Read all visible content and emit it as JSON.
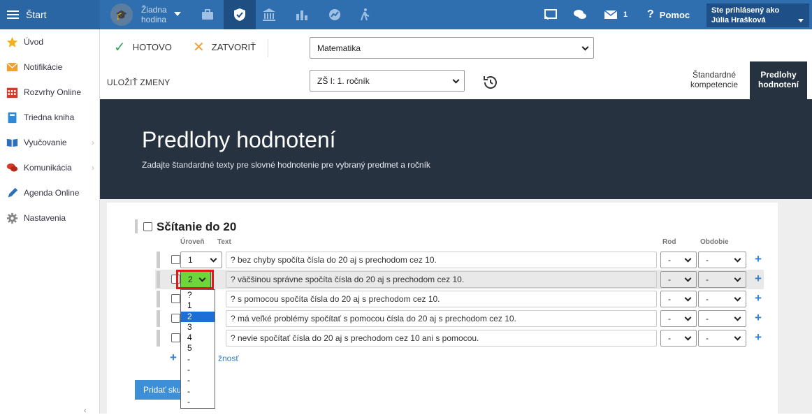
{
  "topbar": {
    "menu_label": "Štart",
    "hodina_label": "Žiadna hodina",
    "messages_count": "1",
    "help_label": "Pomoc",
    "user_caption": "Ste prihlásený ako",
    "user_name": "Júlia Hrašková"
  },
  "sidebar": {
    "items": [
      {
        "label": "Úvod",
        "icon": "star-icon"
      },
      {
        "label": "Notifikácie",
        "icon": "envelope-icon"
      },
      {
        "label": "Rozvrhy Online",
        "icon": "calendar-icon"
      },
      {
        "label": "Triedna kniha",
        "icon": "book-icon"
      },
      {
        "label": "Vyučovanie",
        "icon": "open-book-icon"
      },
      {
        "label": "Komunikácia",
        "icon": "chat-icon"
      },
      {
        "label": "Agenda Online",
        "icon": "pen-icon"
      },
      {
        "label": "Nastavenia",
        "icon": "gear-icon"
      }
    ]
  },
  "toolbar": {
    "done_label": "HOTOVO",
    "close_label": "ZATVORIŤ",
    "save_label": "ULOŽIŤ ZMENY",
    "subject_value": "Matematika",
    "grade_value": "ZŠ I: 1. ročník",
    "tab_standard": "Štandardné kompetencie",
    "tab_templates": "Predlohy hodnotení"
  },
  "hero": {
    "title": "Predlohy hodnotení",
    "subtitle": "Zadajte štandardné texty pre slovné hodnotenie pre vybraný predmet a ročník"
  },
  "group": {
    "title": "Sčítanie do 20",
    "col_level": "Úroveň",
    "col_text": "Text",
    "col_gender": "Rod",
    "col_period": "Obdobie",
    "rows": [
      {
        "level": "1",
        "text": "? bez chyby spočíta čísla do 20 aj s prechodom cez 10.",
        "gender": "-",
        "period": "-"
      },
      {
        "level": "2",
        "text": "? väčšinou správne spočíta čísla do 20 aj s prechodom cez 10.",
        "gender": "-",
        "period": "-"
      },
      {
        "level": "3",
        "text": "? s pomocou spočíta čísla do 20 aj s prechodom cez 10.",
        "gender": "-",
        "period": "-"
      },
      {
        "level": "4",
        "text": "? má veľké problémy spočítať s pomocou čísla do 20 aj s prechodom cez 10.",
        "gender": "-",
        "period": "-"
      },
      {
        "level": "5",
        "text": "? nevie spočítať čísla do 20 aj s prechodom cez 10 ani s pomocou.",
        "gender": "-",
        "period": "-"
      }
    ],
    "add_option_label": "žnosť",
    "add_group_label": "Pridať sku"
  },
  "dropdown": {
    "options": [
      "?",
      "1",
      "2",
      "3",
      "4",
      "5",
      "-",
      "-",
      "-",
      "-",
      "-"
    ],
    "selected": "2"
  },
  "colors": {
    "topbar": "#2f6fb0",
    "hero": "#263240",
    "accent": "#2f7fd4",
    "highlight_green": "#6cd63a",
    "highlight_frame": "#e01818"
  }
}
